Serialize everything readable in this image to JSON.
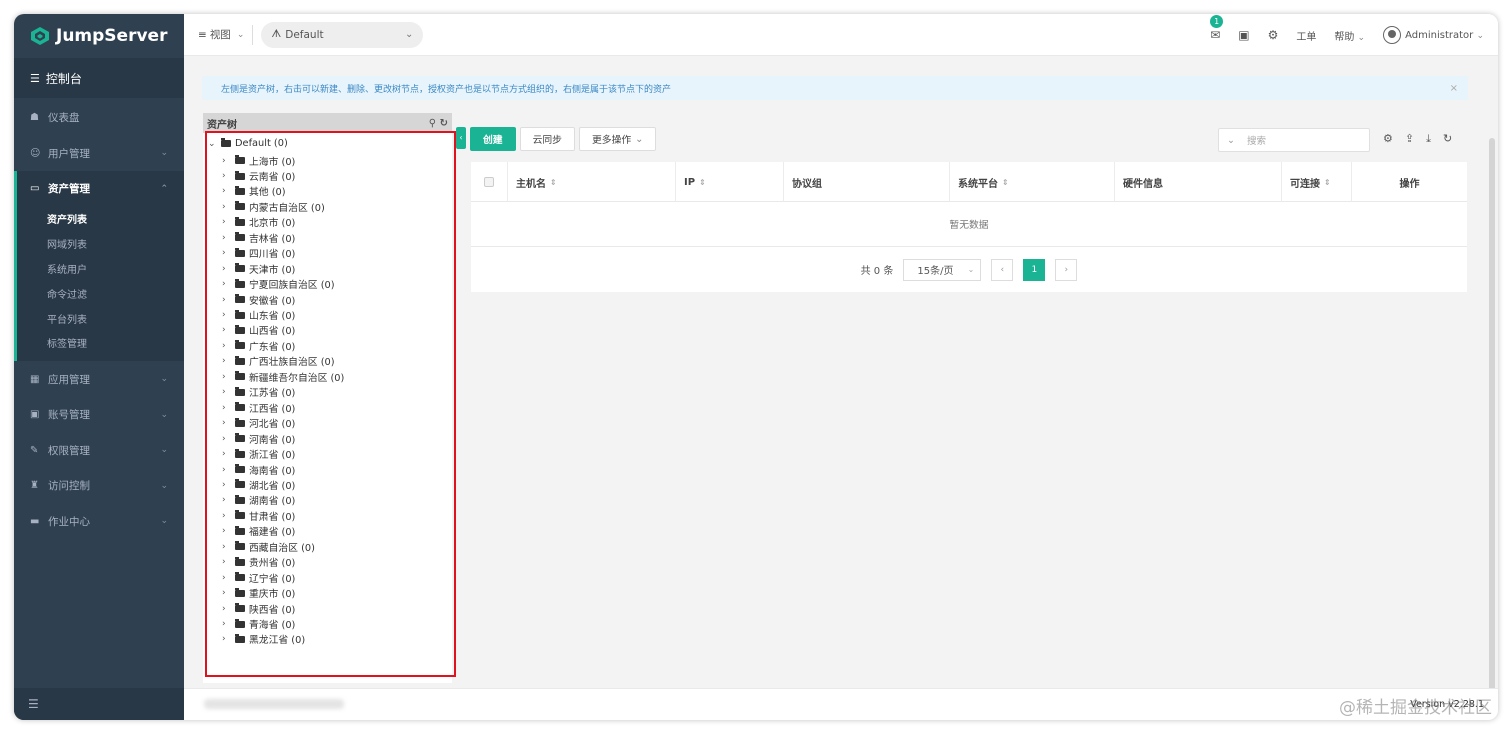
{
  "app": {
    "name": "JumpServer"
  },
  "sidebar": {
    "dashboard_label": "控制台",
    "items": [
      {
        "label": "仪表盘",
        "icon": "dashboard-icon",
        "glyph": "☗"
      },
      {
        "label": "用户管理",
        "icon": "users-icon",
        "glyph": "☺"
      },
      {
        "label": "资产管理",
        "icon": "asset-icon",
        "glyph": "▭"
      },
      {
        "label": "应用管理",
        "icon": "apps-icon",
        "glyph": "▦"
      },
      {
        "label": "账号管理",
        "icon": "account-icon",
        "glyph": "▣"
      },
      {
        "label": "权限管理",
        "icon": "permission-icon",
        "glyph": "✎"
      },
      {
        "label": "访问控制",
        "icon": "access-control-icon",
        "glyph": "♜"
      },
      {
        "label": "作业中心",
        "icon": "job-center-icon",
        "glyph": "▬"
      }
    ],
    "asset_submenu": [
      "资产列表",
      "网域列表",
      "系统用户",
      "命令过滤",
      "平台列表",
      "标签管理"
    ]
  },
  "header": {
    "view_label": "视图",
    "org_value": "Default",
    "mail_badge": "1",
    "ticket_label": "工单",
    "help_label": "帮助",
    "user_name": "Administrator"
  },
  "alert": {
    "text": "左侧是资产树，右击可以新建、删除、更改树节点，授权资产也是以节点方式组织的，右侧是属于该节点下的资产",
    "close": "×"
  },
  "tree": {
    "title": "资产树",
    "root": "Default (0)",
    "nodes": [
      "上海市 (0)",
      "云南省 (0)",
      "其他 (0)",
      "内蒙古自治区 (0)",
      "北京市 (0)",
      "吉林省 (0)",
      "四川省 (0)",
      "天津市 (0)",
      "宁夏回族自治区 (0)",
      "安徽省 (0)",
      "山东省 (0)",
      "山西省 (0)",
      "广东省 (0)",
      "广西壮族自治区 (0)",
      "新疆维吾尔自治区 (0)",
      "江苏省 (0)",
      "江西省 (0)",
      "河北省 (0)",
      "河南省 (0)",
      "浙江省 (0)",
      "海南省 (0)",
      "湖北省 (0)",
      "湖南省 (0)",
      "甘肃省 (0)",
      "福建省 (0)",
      "西藏自治区 (0)",
      "贵州省 (0)",
      "辽宁省 (0)",
      "重庆市 (0)",
      "陕西省 (0)",
      "青海省 (0)",
      "黑龙江省 (0)"
    ]
  },
  "toolbar": {
    "create": "创建",
    "cloud_sync": "云同步",
    "more_actions": "更多操作",
    "search_placeholder": "搜索"
  },
  "table": {
    "columns": [
      "主机名",
      "IP",
      "协议组",
      "系统平台",
      "硬件信息",
      "可连接",
      "操作"
    ],
    "empty_text": "暂无数据"
  },
  "pager": {
    "total": "共 0 条",
    "page_size": "15条/页",
    "current_page": "1"
  },
  "footer": {
    "version": "Version v2.28.1",
    "watermark": "@稀土掘金技术社区"
  },
  "colors": {
    "sidebar_bg": "#2f4050",
    "accent": "#1ab394",
    "highlight_border": "#e0121f"
  }
}
